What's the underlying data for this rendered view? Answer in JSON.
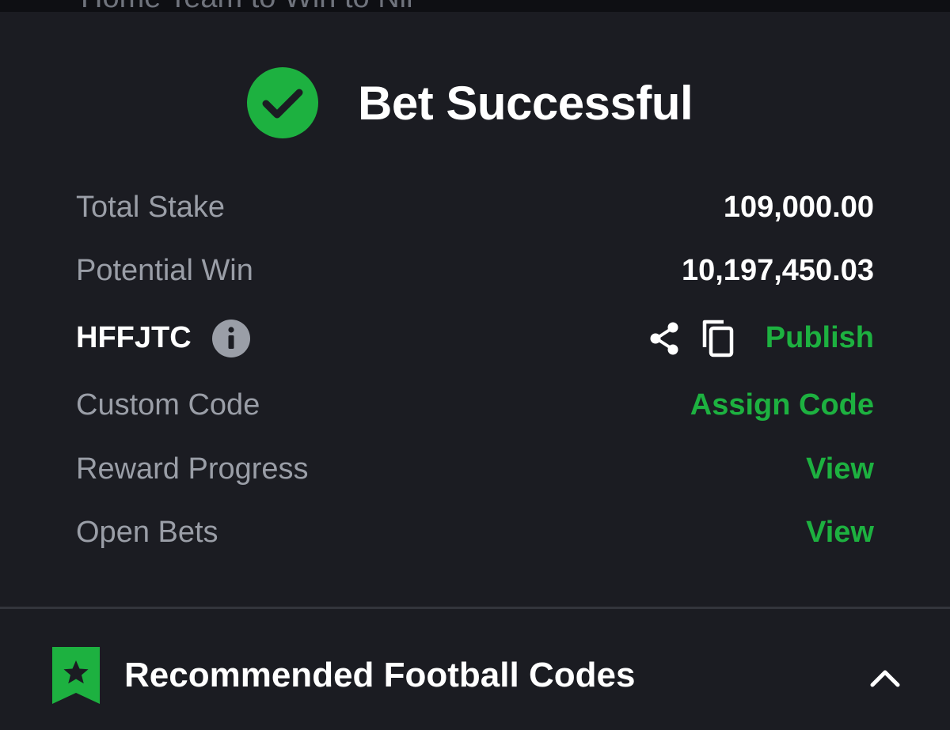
{
  "top_strip": {
    "partial_text": "Home Team to Win to Nil"
  },
  "header": {
    "title": "Bet Successful",
    "status_icon": "check-circle-icon",
    "accent_color": "#1db140"
  },
  "summary": {
    "total_stake_label": "Total Stake",
    "total_stake_value": "109,000.00",
    "potential_win_label": "Potential Win",
    "potential_win_value": "10,197,450.03",
    "booking_code": "HFFJTC",
    "info_icon": "info-icon",
    "share_icon": "share-icon",
    "copy_icon": "copy-icon",
    "publish_label": "Publish",
    "custom_code_label": "Custom Code",
    "assign_code_label": "Assign Code",
    "reward_progress_label": "Reward Progress",
    "reward_progress_link": "View",
    "open_bets_label": "Open Bets",
    "open_bets_link": "View"
  },
  "recommended": {
    "icon": "bookmark-star-icon",
    "title": "Recommended Football Codes",
    "toggle_icon": "chevron-up-icon"
  }
}
